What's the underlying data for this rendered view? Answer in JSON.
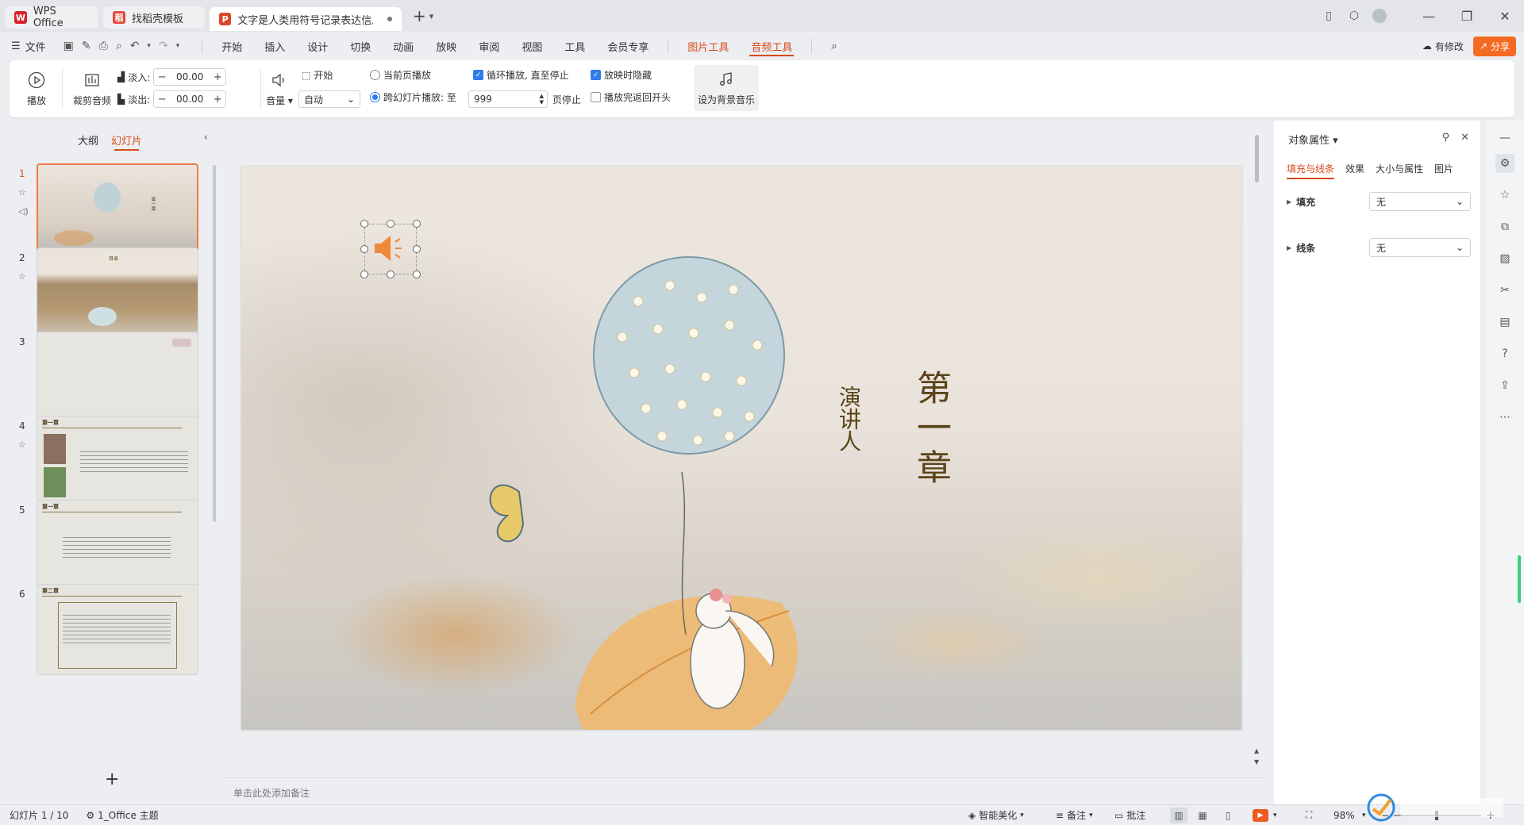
{
  "tabs": [
    {
      "label": "WPS Office"
    },
    {
      "label": "找稻壳模板"
    },
    {
      "label": "文字是人类用符号记录表达信息以"
    }
  ],
  "menu": {
    "file": "文件",
    "items": [
      "开始",
      "插入",
      "设计",
      "切换",
      "动画",
      "放映",
      "审阅",
      "视图",
      "工具",
      "会员专享"
    ],
    "context_tabs": [
      "图片工具",
      "音频工具"
    ],
    "active_context": "音频工具",
    "revise": "有修改",
    "share": "分享"
  },
  "ribbon": {
    "play": "播放",
    "trim": "裁剪音频",
    "fade_in_label": "淡入:",
    "fade_in_value": "00.00",
    "fade_out_label": "淡出:",
    "fade_out_value": "00.00",
    "volume": "音量",
    "start_label": "开始",
    "start_value": "自动",
    "current_page": "当前页播放",
    "cross_slides": "跨幻灯片播放: 至",
    "stop_page_value": "999",
    "stop_suffix": "页停止",
    "loop": "循环播放, 直至停止",
    "hide_when_playing": "放映时隐藏",
    "rewind": "播放完返回开头",
    "set_bg_music": "设为背景音乐",
    "checked": {
      "loop": true,
      "hide": true,
      "rewind": false,
      "cross": true
    }
  },
  "left_pane": {
    "tab_outline": "大纲",
    "tab_slides": "幻灯片",
    "slides": [
      {
        "num": "1"
      },
      {
        "num": "2",
        "title": "目录"
      },
      {
        "num": "3"
      },
      {
        "num": "4",
        "title": "第一章"
      },
      {
        "num": "5",
        "title": "第一章"
      },
      {
        "num": "6",
        "title": "第二章"
      }
    ]
  },
  "slide": {
    "chapter": "第一章",
    "speaker": "演讲人"
  },
  "notes_placeholder": "单击此处添加备注",
  "right_panel": {
    "title": "对象属性",
    "tabs": [
      "填充与线条",
      "效果",
      "大小与属性",
      "图片"
    ],
    "fill_label": "填充",
    "fill_value": "无",
    "line_label": "线条",
    "line_value": "无"
  },
  "status": {
    "slide_count": "幻灯片 1 / 10",
    "theme": "1_Office 主题",
    "beautify": "智能美化",
    "notes": "备注",
    "comments": "批注",
    "zoom": "98%"
  },
  "colors": {
    "accent": "#d84a1b",
    "share": "#f36b23",
    "speaker_icon": "#f0883a",
    "checkbox": "#2f7ce8"
  }
}
